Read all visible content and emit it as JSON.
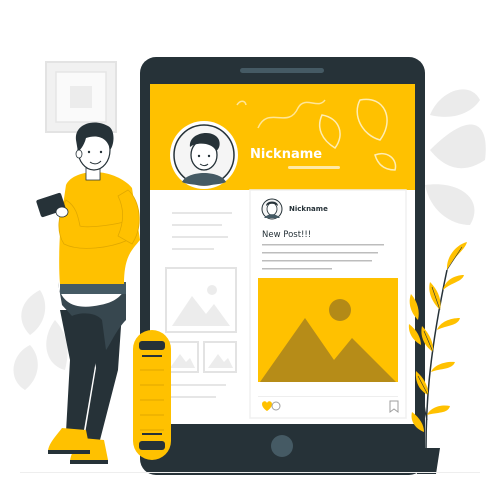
{
  "profile": {
    "nickname": "Nickname"
  },
  "post": {
    "author": "Nickname",
    "text": "New Post!!!"
  },
  "colors": {
    "accent": "#FFC100",
    "dark": "#263238",
    "light_gray": "#EBEBEB"
  },
  "icons": {
    "like": "heart-icon",
    "comment": "comment-icon",
    "bookmark": "bookmark-icon",
    "home": "home-button-icon"
  }
}
